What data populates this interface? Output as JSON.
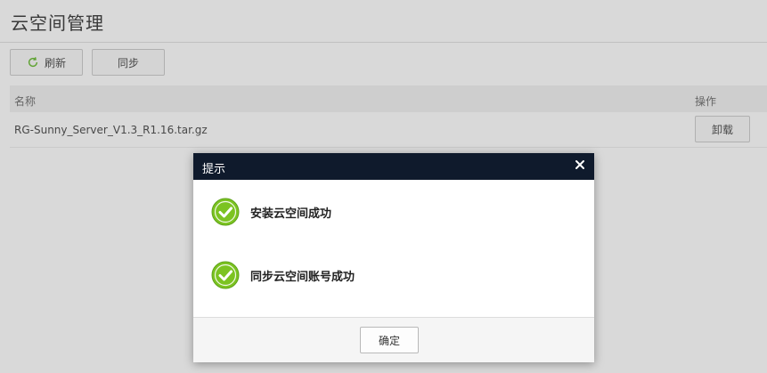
{
  "page": {
    "title": "云空间管理"
  },
  "toolbar": {
    "refresh_label": "刷新",
    "sync_label": "同步"
  },
  "table": {
    "columns": [
      "名称",
      "操作"
    ],
    "rows": [
      {
        "name": "RG-Sunny_Server_V1.3_R1.16.tar.gz",
        "action": "卸载"
      }
    ]
  },
  "dialog": {
    "title": "提示",
    "messages": [
      {
        "text": "安装云空间成功",
        "icon": "success-check-icon"
      },
      {
        "text": "同步云空间账号成功",
        "icon": "success-check-icon"
      }
    ],
    "ok_label": "确定"
  },
  "colors": {
    "dialog_header": "#0f1a2c",
    "success_green": "#7cc321",
    "refresh_icon_green": "#6fbf3a"
  }
}
